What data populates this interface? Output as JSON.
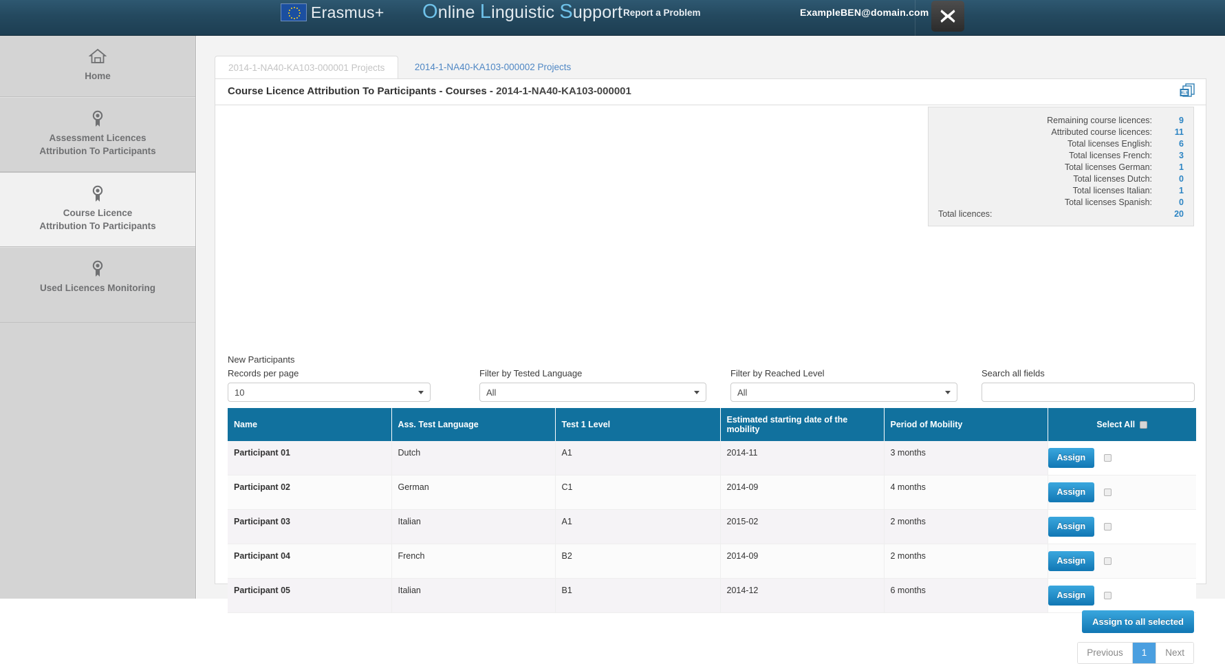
{
  "header": {
    "brand_erasmus": "Erasmus+",
    "brand_ols_parts": {
      "o": "O",
      "nline": "nline ",
      "l": "L",
      "inguistic": "inguistic ",
      "s": "S",
      "upport": "upport"
    },
    "report_problem": "Report a Problem",
    "user_email": "ExampleBEN@domain.com",
    "close_icon": "close-icon"
  },
  "sidebar": {
    "items": [
      {
        "label": "Home",
        "icon": "home-icon",
        "active": false
      },
      {
        "label_line1": "Assessment Licences",
        "label_line2": "Attribution To Participants",
        "icon": "award-icon",
        "active": false
      },
      {
        "label_line1": "Course Licence",
        "label_line2": "Attribution To Participants",
        "icon": "award-icon",
        "active": true
      },
      {
        "label": "Used Licences Monitoring",
        "icon": "award-icon",
        "active": false
      }
    ]
  },
  "tabs": [
    {
      "label": "2014-1-NA40-KA103-000001 Projects",
      "active": true
    },
    {
      "label": "2014-1-NA40-KA103-000002 Projects",
      "active": false
    }
  ],
  "panel": {
    "title_main": "Course Licence Attribution To Participants - Courses",
    "title_sep": " - ",
    "title_project": "2014-1-NA40-KA103-000001",
    "export_icon": "xls-export-icon"
  },
  "stats": {
    "rows": [
      {
        "label": "Remaining course licences:",
        "value": "9",
        "indent": false,
        "total": false
      },
      {
        "label": "Attributed course licences:",
        "value": "11",
        "indent": false,
        "total": false
      },
      {
        "label": "Total licenses English:",
        "value": "6",
        "indent": true,
        "total": false
      },
      {
        "label": "Total licenses French:",
        "value": "3",
        "indent": true,
        "total": false
      },
      {
        "label": "Total licenses German:",
        "value": "1",
        "indent": true,
        "total": false
      },
      {
        "label": "Total licenses Dutch:",
        "value": "0",
        "indent": true,
        "total": false
      },
      {
        "label": "Total licenses Italian:",
        "value": "1",
        "indent": true,
        "total": false
      },
      {
        "label": "Total licenses Spanish:",
        "value": "0",
        "indent": true,
        "total": false
      },
      {
        "label": "Total licences:",
        "value": "20",
        "indent": false,
        "total": true
      }
    ]
  },
  "filters": {
    "section_label": "New Participants",
    "records_per_page": {
      "label": "Records per page",
      "value": "10"
    },
    "tested_language": {
      "label": "Filter by Tested Language",
      "value": "All"
    },
    "reached_level": {
      "label": "Filter by Reached Level",
      "value": "All"
    },
    "search": {
      "label": "Search all fields",
      "value": "",
      "placeholder": ""
    }
  },
  "table": {
    "columns": [
      "Name",
      "Ass. Test Language",
      "Test 1 Level",
      "Estimated starting date of the mobility",
      "Period of Mobility"
    ],
    "select_all_label": "Select All",
    "assign_label": "Assign",
    "rows": [
      {
        "name": "Participant 01",
        "language": "Dutch",
        "level": "A1",
        "start": "2014-11",
        "period": "3 months"
      },
      {
        "name": "Participant 02",
        "language": "German",
        "level": "C1",
        "start": "2014-09",
        "period": "4 months"
      },
      {
        "name": "Participant 03",
        "language": "Italian",
        "level": "A1",
        "start": "2015-02",
        "period": "2 months"
      },
      {
        "name": "Participant 04",
        "language": "French",
        "level": "B2",
        "start": "2014-09",
        "period": "2 months"
      },
      {
        "name": "Participant 05",
        "language": "Italian",
        "level": "B1",
        "start": "2014-12",
        "period": "6 months"
      }
    ]
  },
  "footer": {
    "assign_all_label": "Assign to all selected",
    "pagination": {
      "previous": "Previous",
      "page": "1",
      "next": "Next"
    }
  },
  "colors": {
    "accent_blue": "#11719e",
    "button_blue": "#1177b4",
    "stat_value": "#2d85c4",
    "header_dark": "#24495f"
  }
}
